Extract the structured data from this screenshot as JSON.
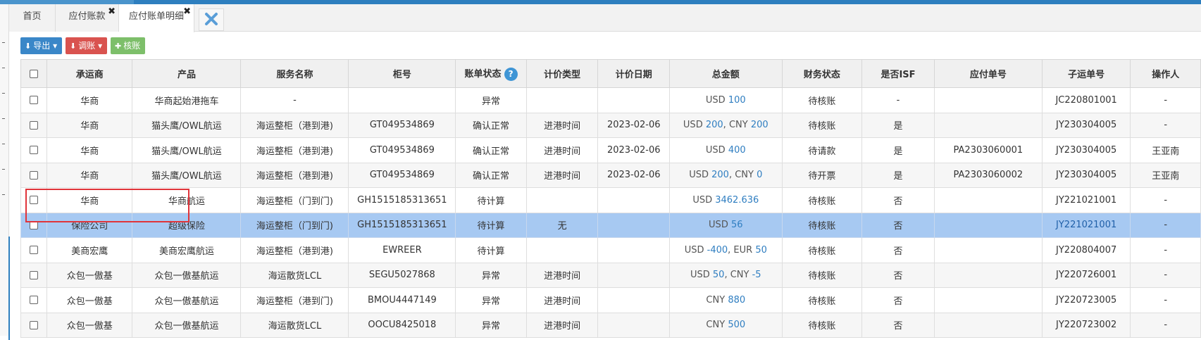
{
  "tabs": [
    {
      "label": "首页",
      "closable": false
    },
    {
      "label": "应付账款",
      "closable": true
    },
    {
      "label": "应付账单明细",
      "closable": true,
      "active": true
    }
  ],
  "toolbar": {
    "export_label": "导出",
    "adjust_label": "调账",
    "verify_label": "核账"
  },
  "colors": {
    "accent": "#2e7fbf",
    "selected_row": "#a7c9f2",
    "link": "#2f7ec1",
    "highlight_box": "#e0343a"
  },
  "table": {
    "headers": [
      "承运商",
      "产品",
      "服务名称",
      "柜号",
      "账单状态",
      "计价类型",
      "计价日期",
      "总金额",
      "财务状态",
      "是否ISF",
      "应付单号",
      "子运单号",
      "操作人"
    ],
    "rows": [
      {
        "carrier": "华商",
        "product": "华商起始港拖车",
        "service": "-",
        "container": "",
        "bill_status": "异常",
        "pricing_type": "",
        "pricing_date": "",
        "amount": [
          {
            "cur": "USD",
            "val": "100"
          }
        ],
        "finance_status": "待核账",
        "isf": "-",
        "payable_no": "",
        "sub_waybill": "JC220801001",
        "operator": "-"
      },
      {
        "carrier": "华商",
        "product": "猫头鹰/OWL航运",
        "service": "海运整柜（港到港)",
        "container": "GT049534869",
        "bill_status": "确认正常",
        "pricing_type": "进港时间",
        "pricing_date": "2023-02-06",
        "amount": [
          {
            "cur": "USD",
            "val": "200"
          },
          {
            "cur": "CNY",
            "val": "200"
          }
        ],
        "finance_status": "待核账",
        "isf": "是",
        "payable_no": "",
        "sub_waybill": "JY230304005",
        "operator": "-"
      },
      {
        "carrier": "华商",
        "product": "猫头鹰/OWL航运",
        "service": "海运整柜（港到港)",
        "container": "GT049534869",
        "bill_status": "确认正常",
        "pricing_type": "进港时间",
        "pricing_date": "2023-02-06",
        "amount": [
          {
            "cur": "USD",
            "val": "400"
          }
        ],
        "finance_status": "待请款",
        "isf": "是",
        "payable_no": "PA2303060001",
        "sub_waybill": "JY230304005",
        "operator": "王亚南"
      },
      {
        "carrier": "华商",
        "product": "猫头鹰/OWL航运",
        "service": "海运整柜（港到港)",
        "container": "GT049534869",
        "bill_status": "确认正常",
        "pricing_type": "进港时间",
        "pricing_date": "2023-02-06",
        "amount": [
          {
            "cur": "USD",
            "val": "200"
          },
          {
            "cur": "CNY",
            "val": "0"
          }
        ],
        "finance_status": "待开票",
        "isf": "是",
        "payable_no": "PA2303060002",
        "sub_waybill": "JY230304005",
        "operator": "王亚南"
      },
      {
        "carrier": "华商",
        "product": "华商航运",
        "service": "海运整柜（门到门)",
        "container": "GH1515185313651",
        "bill_status": "待计算",
        "pricing_type": "",
        "pricing_date": "",
        "amount": [
          {
            "cur": "USD",
            "val": "3462.636"
          }
        ],
        "finance_status": "待核账",
        "isf": "否",
        "payable_no": "",
        "sub_waybill": "JY221021001",
        "operator": "-"
      },
      {
        "carrier": "保险公司",
        "product": "超级保险",
        "service": "海运整柜（门到门)",
        "container": "GH1515185313651",
        "bill_status": "待计算",
        "pricing_type": "无",
        "pricing_date": "",
        "amount": [
          {
            "cur": "USD",
            "val": "56"
          }
        ],
        "finance_status": "待核账",
        "isf": "否",
        "payable_no": "",
        "sub_waybill": "JY221021001",
        "operator": "-"
      },
      {
        "carrier": "美商宏鹰",
        "product": "美商宏鹰航运",
        "service": "海运整柜（港到港)",
        "container": "EWREER",
        "bill_status": "待计算",
        "pricing_type": "",
        "pricing_date": "",
        "amount": [
          {
            "cur": "USD",
            "val": "-400"
          },
          {
            "cur": "EUR",
            "val": "50"
          }
        ],
        "finance_status": "待核账",
        "isf": "否",
        "payable_no": "",
        "sub_waybill": "JY220804007",
        "operator": "-"
      },
      {
        "carrier": "众包一傲基",
        "product": "众包一傲基航运",
        "service": "海运散货LCL",
        "container": "SEGU5027868",
        "bill_status": "异常",
        "pricing_type": "进港时间",
        "pricing_date": "",
        "amount": [
          {
            "cur": "USD",
            "val": "50"
          },
          {
            "cur": "CNY",
            "val": "-5"
          }
        ],
        "finance_status": "待核账",
        "isf": "否",
        "payable_no": "",
        "sub_waybill": "JY220726001",
        "operator": "-"
      },
      {
        "carrier": "众包一傲基",
        "product": "众包一傲基航运",
        "service": "海运整柜（港到门)",
        "container": "BMOU4447149",
        "bill_status": "异常",
        "pricing_type": "进港时间",
        "pricing_date": "",
        "amount": [
          {
            "cur": "CNY",
            "val": "880"
          }
        ],
        "finance_status": "待核账",
        "isf": "否",
        "payable_no": "",
        "sub_waybill": "JY220723005",
        "operator": "-"
      },
      {
        "carrier": "众包一傲基",
        "product": "众包一傲基航运",
        "service": "海运散货LCL",
        "container": "OOCU8425018",
        "bill_status": "异常",
        "pricing_type": "进港时间",
        "pricing_date": "",
        "amount": [
          {
            "cur": "CNY",
            "val": "500"
          }
        ],
        "finance_status": "待核账",
        "isf": "否",
        "payable_no": "",
        "sub_waybill": "JY220723002",
        "operator": "-"
      }
    ],
    "selected_row_index": 5
  }
}
